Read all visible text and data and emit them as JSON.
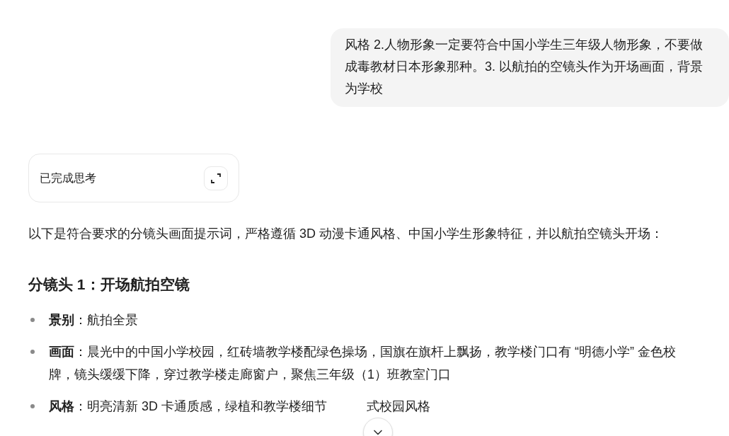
{
  "user_message": {
    "text": "风格 2.人物形象一定要符合中国小学生三年级人物形象，不要做成毒教材日本形象那种。3. 以航拍的空镜头作为开场画面，背景为学校"
  },
  "thinking": {
    "label": "已完成思考",
    "expanded": false
  },
  "intro": "以下是符合要求的分镜头画面提示词，严格遵循 3D 动漫卡通风格、中国小学生形象特征，并以航拍空镜头开场：",
  "shot": {
    "heading": "分镜头 1：开场航拍空镜",
    "items": [
      {
        "label": "景别",
        "text": "：航拍全景"
      },
      {
        "label": "画面",
        "text": "：晨光中的中国小学校园，红砖墙教学楼配绿色操场，国旗在旗杆上飘扬，教学楼门口有 “明德小学” 金色校牌，镜头缓缓下降，穿过教学楼走廊窗户，聚焦三年级（1）班教室门口"
      },
      {
        "label": "风格",
        "text": "：明亮清新 3D 卡通质感，绿植和教学楼细节",
        "text_after": "式校园风格"
      }
    ]
  }
}
